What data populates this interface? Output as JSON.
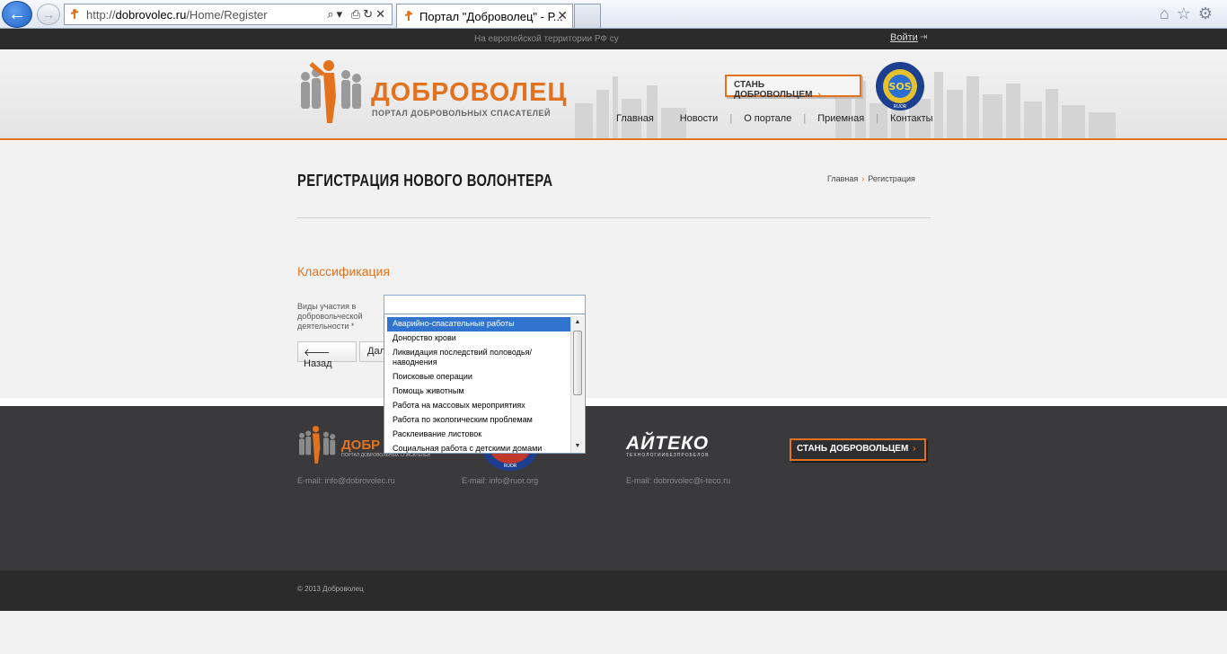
{
  "browser": {
    "url_prefix": "http://",
    "url_domain": "dobrovolec.ru",
    "url_path": "/Home/Register",
    "tab_title": "Портал \"Доброволец\" - Р...",
    "back_glyph": "←",
    "forward_glyph": "→",
    "close_tab_glyph": "✕",
    "address_tools": "⌕▾ ⎙↻✕",
    "right_icons": "⌂☆⚙"
  },
  "topbar": {
    "message": "На европейской территории РФ су",
    "login_label": "Войти",
    "login_arrow": "⇥"
  },
  "header": {
    "logo_name": "ДОБРОВОЛЕЦ",
    "logo_subtitle": "ПОРТАЛ ДОБРОВОЛЬНЫХ СПАСАТЕЛЕЙ",
    "cta_label": "СТАНЬ ДОБРОВОЛЬЦЕМ",
    "cta_arrow": "›",
    "emblem_ring_text": "РОССИЙСКИЙ СОЮЗ СПАСАТЕЛЕЙ",
    "emblem_center": "SOS",
    "emblem_bottom": "RUOR",
    "nav": [
      "Главная",
      "Новости",
      "О портале",
      "Приемная",
      "Контакты"
    ],
    "nav_separator": "|"
  },
  "content": {
    "page_title": "РЕГИСТРАЦИЯ НОВОГО ВОЛОНТЕРА",
    "breadcrumb_home": "Главная",
    "breadcrumb_arrow": "›",
    "breadcrumb_current": "Регистрация",
    "section_title": "Классификация",
    "field_label": "Виды участия в добровольческой деятельности *",
    "back_button": "Назад",
    "back_icon": "🡐",
    "next_button": "Далее",
    "dropdown_options": [
      "Аварийно-спасательные работы",
      "Донорство крови",
      "Ликвидация последствий половодья/наводнения",
      "Поисковые операции",
      "Помощь животным",
      "Работа на массовых мероприятиях",
      "Работа по экологическим проблемам",
      "Расклеивание листовок",
      "Социальная работа с детскими домами"
    ],
    "dropdown_selected_index": 0,
    "scroll_up_glyph": "▲",
    "scroll_down_glyph": "▼"
  },
  "footer": {
    "logo_name": "ДОБР",
    "logo_subtitle": "ПОРТАЛ ДОБРОВОЛЬНЫХ СПАСАТЕЛЕЙ",
    "emblem_bottom": "RUOR",
    "partner_name": "АЙТЕКО",
    "partner_subtitle": "ТЕХНОЛОГИИБЕЗПРОБЕЛОВ",
    "cta_label": "СТАНЬ ДОБРОВОЛЬЦЕМ",
    "cta_arrow": "›",
    "emails": [
      "E-mail: info@dobrovolec.ru",
      "E-mail: info@ruor.org",
      "E-mail: dobrovolec@i-teco.ru"
    ],
    "copyright": "© 2013 Доброволец"
  },
  "colors": {
    "accent": "#e2721d",
    "dark": "#2b2b2c",
    "footer": "#3a3a3c",
    "selection": "#3074d0"
  }
}
